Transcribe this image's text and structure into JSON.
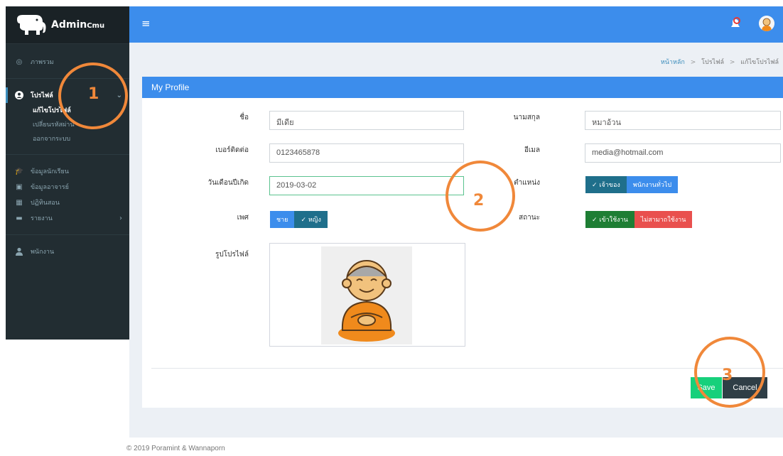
{
  "brand": {
    "name_main": "Admin",
    "name_small": "Cmu",
    "logo_icon": "elephant-logo"
  },
  "sidebar": {
    "overview": "ภาพรวม",
    "profile": "โปรไฟล์",
    "edit_profile": "แก้ไขโปรไฟล์",
    "change_password": "เปลี่ยนรหัสผ่าน",
    "logout": "ออกจากระบบ",
    "students": "ข้อมูลนักเรียน",
    "teachers": "ข้อมูลอาจารย์",
    "calendar": "ปฏิทินสอน",
    "reports": "รายงาน",
    "staff": "พนักงาน"
  },
  "topbar": {
    "menu_icon": "hamburger-icon",
    "notification_icon": "bell-icon",
    "avatar_icon": "monk-avatar"
  },
  "breadcrumb": {
    "home": "หน้าหลัก",
    "profile": "โปรไฟล์",
    "current": "แก้ไขโปรไฟล์",
    "separator": ">"
  },
  "profile_box": {
    "title": "My Profile",
    "first_name_label": "ชื่อ",
    "first_name_value": "มีเดีย",
    "last_name_label": "นามสกุล",
    "last_name_value": "หมาอ้วน",
    "phone_label": "เบอร์ติดต่อ",
    "phone_value": "0123465878",
    "email_label": "อีเมล",
    "email_value": "media@hotmail.com",
    "birthdate_label": "วันเดือนปีเกิด",
    "birthdate_value": "2019-03-02",
    "position_label": "ตำแหน่ง",
    "position_owner": "✓ เจ้าของ",
    "position_staff": "พนักงานทั่วไป",
    "gender_label": "เพศ",
    "gender_male": "ชาย",
    "gender_female": "✓ หญิง",
    "status_label": "สถานะ",
    "status_active": "✓ เข้าใช้งาน",
    "status_inactive": "ไม่สามาถใช้งาน",
    "photo_label": "รูปโปรไฟล์",
    "save_label": "Save",
    "cancel_label": "Cancel"
  },
  "annotations": [
    "1",
    "2",
    "3"
  ],
  "footer": "© 2019 Poramint & Wannaporn",
  "colors": {
    "primary": "#3c8dec",
    "sidebar": "#222d32",
    "annotation": "#f0883a",
    "save": "#17d07b",
    "cancel": "#2f3e46"
  }
}
